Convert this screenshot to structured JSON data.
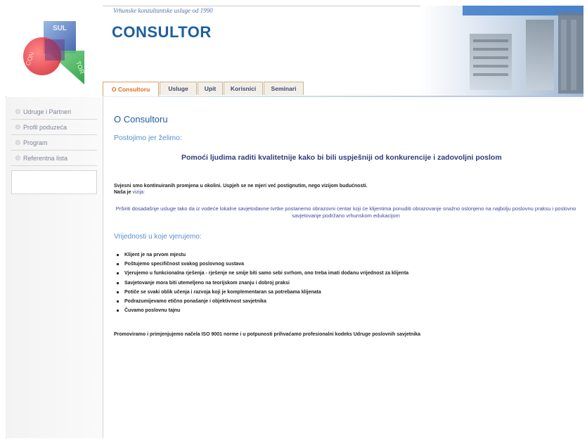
{
  "header": {
    "tagline": "Vrhunske konzultantske usluge od 1990",
    "brand": "CONSULTOR",
    "logo_letters": [
      "SUL",
      "CON",
      "TOR"
    ]
  },
  "tabs": [
    {
      "label": "O Consultoru",
      "active": true
    },
    {
      "label": "Usluge",
      "active": false
    },
    {
      "label": "Upit",
      "active": false
    },
    {
      "label": "Korisnici",
      "active": false
    },
    {
      "label": "Seminari",
      "active": false
    }
  ],
  "sidebar": {
    "items": [
      {
        "label": "Udruge i Partneri"
      },
      {
        "label": "Profil poduzeća"
      },
      {
        "label": "Program"
      },
      {
        "label": "Referentna lista"
      }
    ]
  },
  "main": {
    "title": "O Consultoru",
    "subtitle": "Postojimo jer želimo:",
    "slogan": "Pomoći ljudima raditi kvalitetnije kako bi bili uspješniji od konkurencije i zadovoljni poslom",
    "intro_line1": "Svjesni smo kontinuiranih promjena u okolini. Uspjeh se ne mjeri već postignutim, nego vizijom budućnosti.",
    "intro_line2_prefix": "Naša je",
    "intro_line2_link": "vizija:",
    "mission": "Prširiti dosadašnje usluge tako da iz vodeće lokalne savjetodavne tvrtke postanemo obrazovni centar koji će klijentima ponuditi obrazovanje snažno oslonjeno na najbolju poslovnu praksu i poslovno savjetovanje podržano vrhunskom edukacijom",
    "values_title": "Vrijednosti u koje vjerujemo:",
    "values": [
      "Klijent je na prvom mjestu",
      "Poštujemo specifičnost svakog poslovnog sustava",
      "Vjerujemo u funkcionalna rješenja - rješenje ne smije biti samo sebi svrhom, ono treba imati dodanu vrijednost za klijenta",
      "Savjetovanje mora biti utemeljeno na teorijskom znanju i dobroj praksi",
      "Potiče se svaki oblik učenja i razvoja koji je komplementaran sa potrebama klijenata",
      "Podrazumijevamo etično ponašanje i objektivnost savjetnika",
      "Čuvamo poslovnu tajnu"
    ],
    "footer": "Promoviramo i primjenjujemo načela ISO 9001 norme i u potpunosti prihvaćamo profesionalni kodeks Udruge poslovnih savjetnika"
  },
  "colors": {
    "brand_blue": "#1d5fa0",
    "active_tab": "#e06b16",
    "slogan": "#2e3b7a"
  }
}
